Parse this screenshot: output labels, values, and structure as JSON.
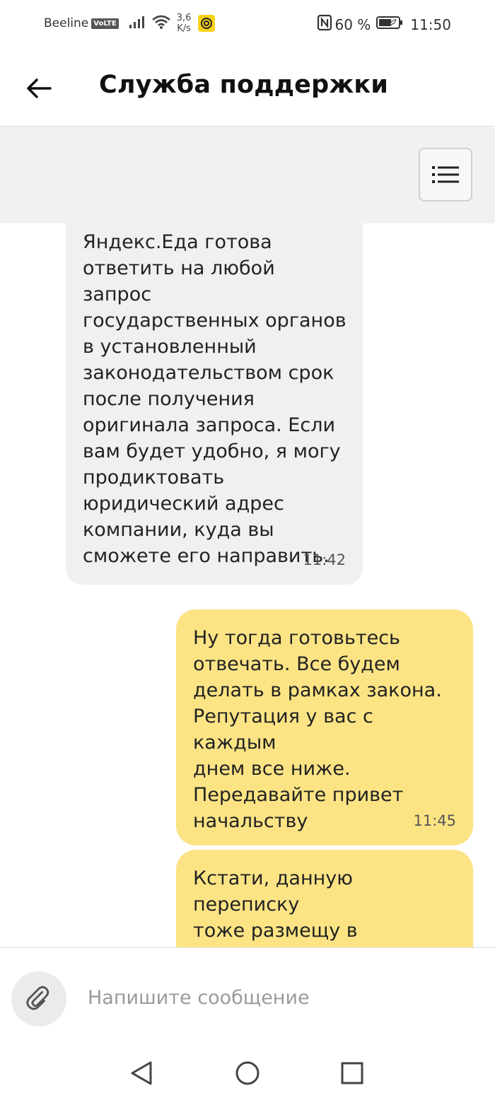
{
  "status_bar": {
    "carrier": "Beeline",
    "network_badge": "VoLTE",
    "speed_value": "3,6",
    "speed_unit": "K/s",
    "battery_percent": "60 %",
    "time": "11:50",
    "icons": [
      "signal-icon",
      "wifi-icon",
      "app-notification-icon",
      "nfc-icon",
      "battery-icon"
    ]
  },
  "header": {
    "title": "Служба поддержки",
    "back_icon": "arrow-left-icon"
  },
  "toolbar": {
    "menu_icon": "list-menu-icon"
  },
  "messages": [
    {
      "direction": "incoming",
      "text": "Яндекс.Еда готова\nответить на любой запрос\nгосударственных органов\nв установленный\nзаконодательством срок\nпосле получения\nоригинала запроса. Если\nвам будет удобно, я могу\nпродиктовать\nюридический адрес\nкомпании, куда вы\nсможете его направить.",
      "time": "11:42"
    },
    {
      "direction": "outgoing",
      "text": "Ну тогда готовьтесь\nотвечать. Все будем\nделать в рамках закона.\nРепутация у вас с каждым\nднем все ниже.\nПередавайте привет\nначальству",
      "time": "11:45"
    },
    {
      "direction": "outgoing",
      "text": "Кстати, данную переписку\nтоже размещу в открытых\nисточниках. Чтобы",
      "time": ""
    }
  ],
  "composer": {
    "placeholder": "Напишите сообщение",
    "value": "",
    "attach_icon": "paperclip-icon"
  },
  "nav_bar": {
    "icons": [
      "back-triangle-icon",
      "home-circle-icon",
      "recents-square-icon"
    ]
  },
  "colors": {
    "outgoing_bubble": "#fce485",
    "incoming_bubble": "#f1f0ef",
    "toolbar_background": "#f2f1f0",
    "accent_yellow": "#f7d21b"
  }
}
